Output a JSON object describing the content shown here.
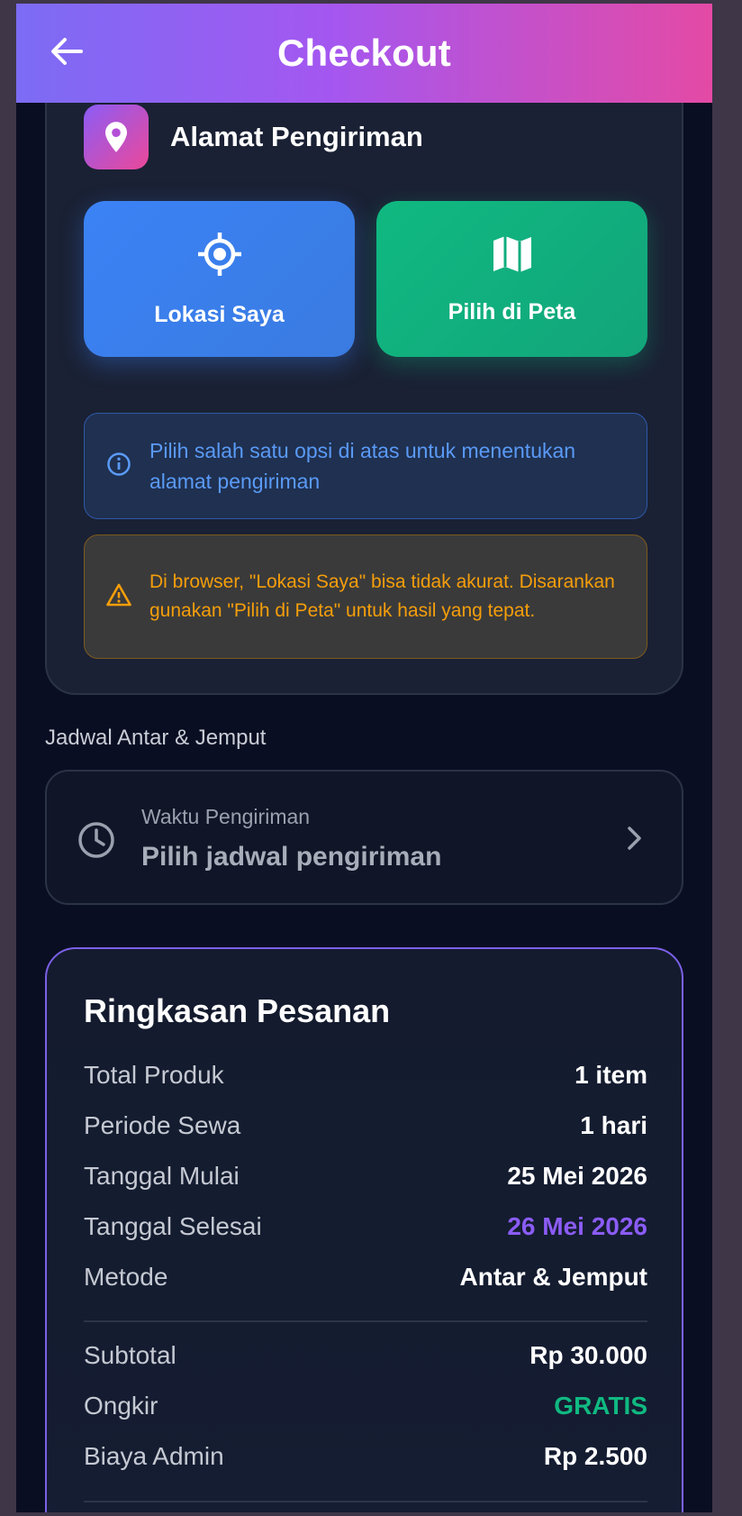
{
  "header": {
    "title": "Checkout",
    "back_icon": "arrow-left-icon"
  },
  "address": {
    "title": "Alamat Pengiriman",
    "my_location_label": "Lokasi Saya",
    "pick_on_map_label": "Pilih di Peta",
    "info_text": "Pilih salah satu opsi di atas untuk menentukan alamat pengiriman",
    "warning_text": "Di browser, \"Lokasi Saya\" bisa tidak akurat. Disarankan gunakan \"Pilih di Peta\" untuk hasil yang tepat."
  },
  "schedule": {
    "section_label": "Jadwal Antar & Jemput",
    "subtitle": "Waktu Pengiriman",
    "placeholder": "Pilih jadwal pengiriman"
  },
  "summary": {
    "title": "Ringkasan Pesanan",
    "rows": [
      {
        "label": "Total Produk",
        "value": "1 item"
      },
      {
        "label": "Periode Sewa",
        "value": "1 hari"
      },
      {
        "label": "Tanggal Mulai",
        "value": "25 Mei 2026"
      },
      {
        "label": "Tanggal Selesai",
        "value": "26 Mei 2026"
      },
      {
        "label": "Metode",
        "value": "Antar & Jemput"
      }
    ],
    "costs": [
      {
        "label": "Subtotal",
        "value": "Rp 30.000"
      },
      {
        "label": "Ongkir",
        "value": "GRATIS"
      },
      {
        "label": "Biaya Admin",
        "value": "Rp 2.500"
      }
    ]
  },
  "colors": {
    "accent_purple": "#8b5cf6",
    "free_green": "#10b981",
    "info_blue": "#5a9af6",
    "warning_orange": "#f59e0b"
  }
}
